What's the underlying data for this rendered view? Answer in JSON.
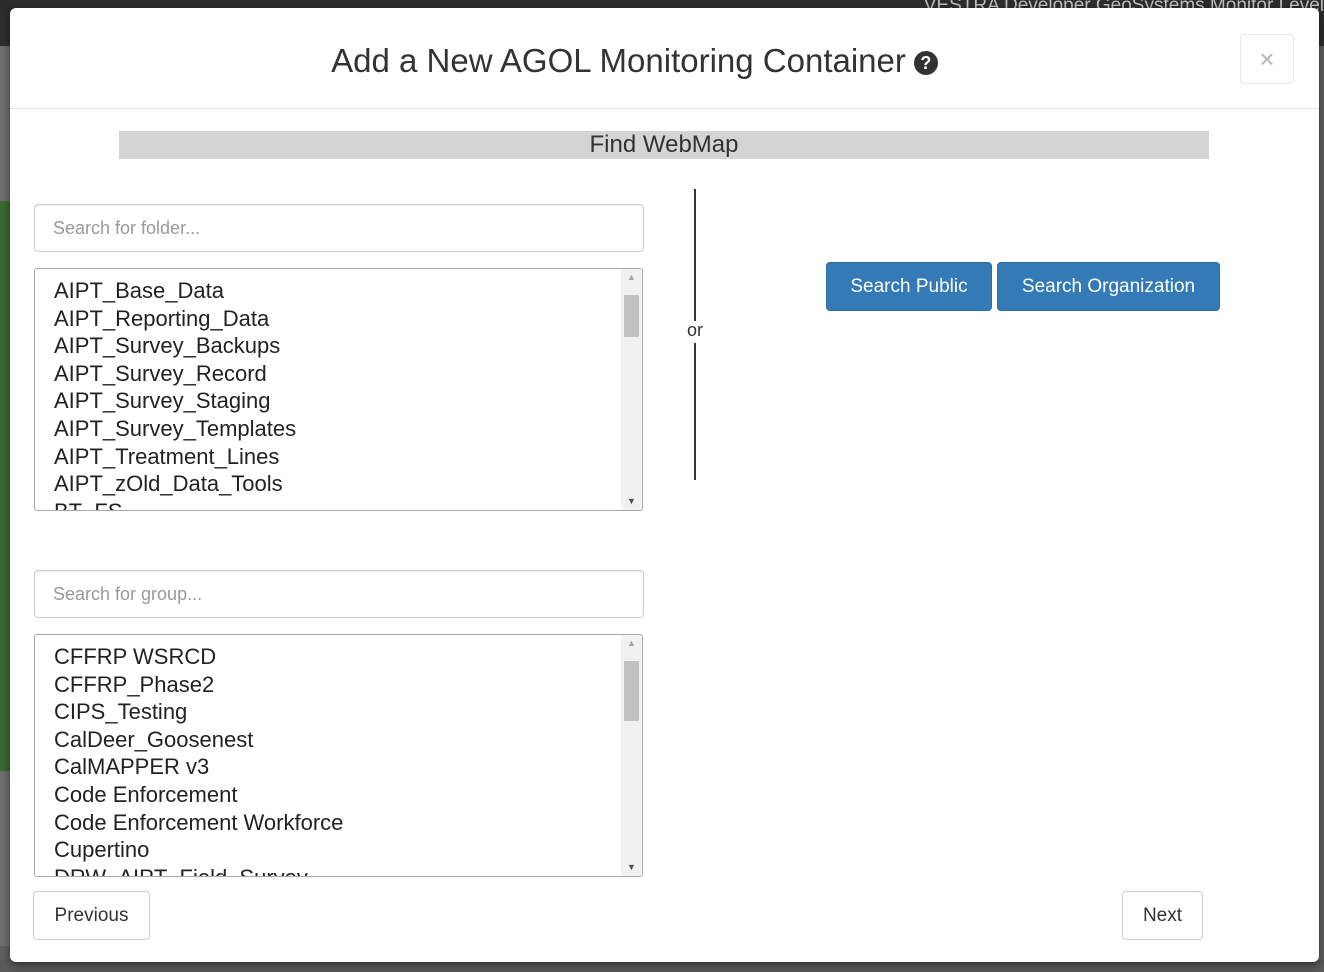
{
  "background": {
    "top_text": "VESTRA Developer GeoSystems Monitor Level"
  },
  "modal": {
    "title": "Add a New AGOL Monitoring Container",
    "help_icon_glyph": "?",
    "close_label": "×"
  },
  "find_webmap": {
    "section_title": "Find WebMap",
    "folder_search": {
      "placeholder": "Search for folder...",
      "value": ""
    },
    "folders": [
      "AIPT_Base_Data",
      "AIPT_Reporting_Data",
      "AIPT_Survey_Backups",
      "AIPT_Survey_Record",
      "AIPT_Survey_Staging",
      "AIPT_Survey_Templates",
      "AIPT_Treatment_Lines",
      "AIPT_zOld_Data_Tools",
      "BT_FS"
    ],
    "group_search": {
      "placeholder": "Search for group...",
      "value": ""
    },
    "groups": [
      "CFFRP WSRCD",
      "CFFRP_Phase2",
      "CIPS_Testing",
      "CalDeer_Goosenest",
      "CalMAPPER v3",
      "Code Enforcement",
      "Code Enforcement Workforce",
      "Cupertino",
      "DRW_AIPT_Field_Survey"
    ],
    "or_label": "or",
    "search_public_label": "Search Public",
    "search_org_label": "Search Organization"
  },
  "footer": {
    "previous_label": "Previous",
    "next_label": "Next"
  }
}
